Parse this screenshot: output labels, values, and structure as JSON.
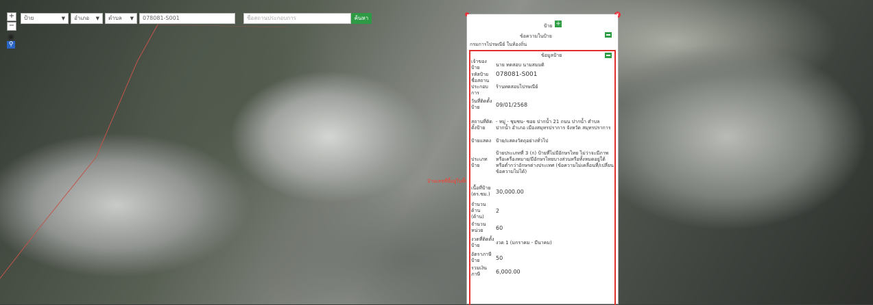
{
  "toolbar": {
    "select1": "ป้าย",
    "select2": "อำเภอ",
    "select3": "ตำบล",
    "code_value": "078081-S001",
    "name_placeholder": "ชื่อสถานประกอบการ",
    "search_label": "ค้นหา"
  },
  "map": {
    "feature_label": "บ้านเลขที่นี้อยู่ในพื้นที่"
  },
  "panel": {
    "title": "ป้าย",
    "message_header": "ข้อความในป้าย",
    "message_text": "กรมการไปรษณีย์ ในท้องถิ่น",
    "info_header": "ข้อมูลป้าย",
    "rows": [
      {
        "key": "เจ้าของป้าย",
        "value": "นาย ทดสอบ นามสมมติ"
      },
      {
        "key": "รหัสป้าย",
        "value": "078081-S001"
      },
      {
        "key": "ชื่อสถานประกอบการ",
        "value": "ร้านทดสอบไปรษณีย์"
      },
      {
        "key": "วันที่ติดตั้งป้าย",
        "value": "09/01/2568"
      },
      {
        "key": "สถานที่ติดตั้งป้าย",
        "value": "- หมู่ - ชุมชน- ซอย ปากน้ำ 21 ถนน ปากน้ำ ตำบล ปากน้ำ อำเภอ เมืองสมุทรปราการ จังหวัด สมุทรปราการ"
      },
      {
        "key": "ป้ายแสดง",
        "value": "ป้าย/แสดงวัตถุอย่างทั่วไป"
      },
      {
        "key": "ประเภทป้าย",
        "value": "ป้ายประเภทที่ 3 (ก) ป้ายที่ไม่มีอักษรไทย ไม่ว่าจะมีภาพหรือเครื่องหมาย/มีอักษรไทยบางส่วนหรือทั้งหมดอยู่ใต้หรือต่ำกว่าอักษรต่างประเทศ (ข้อความไม่เคลื่อนที่/เปลี่ยนข้อความไม่ได้)"
      },
      {
        "key": "เนื้อที่ป้าย (ตร.ซม.)",
        "value": "30,000.00"
      },
      {
        "key": "จำนวนด้าน (ด้าน)",
        "value": "2"
      },
      {
        "key": "จำนวนหน่วย",
        "value": "60"
      },
      {
        "key": "งวดที่ติดตั้งป้าย",
        "value": "งวด 1 (มกราคม - มีนาคม)"
      },
      {
        "key": "อัตราภาษีป้าย",
        "value": "50"
      },
      {
        "key": "รวมเงินภาษี",
        "value": "6,000.00"
      }
    ]
  },
  "colors": {
    "accent_green": "#2e9a45",
    "highlight_red": "#e0302c",
    "search_blue": "#2a64c5"
  }
}
